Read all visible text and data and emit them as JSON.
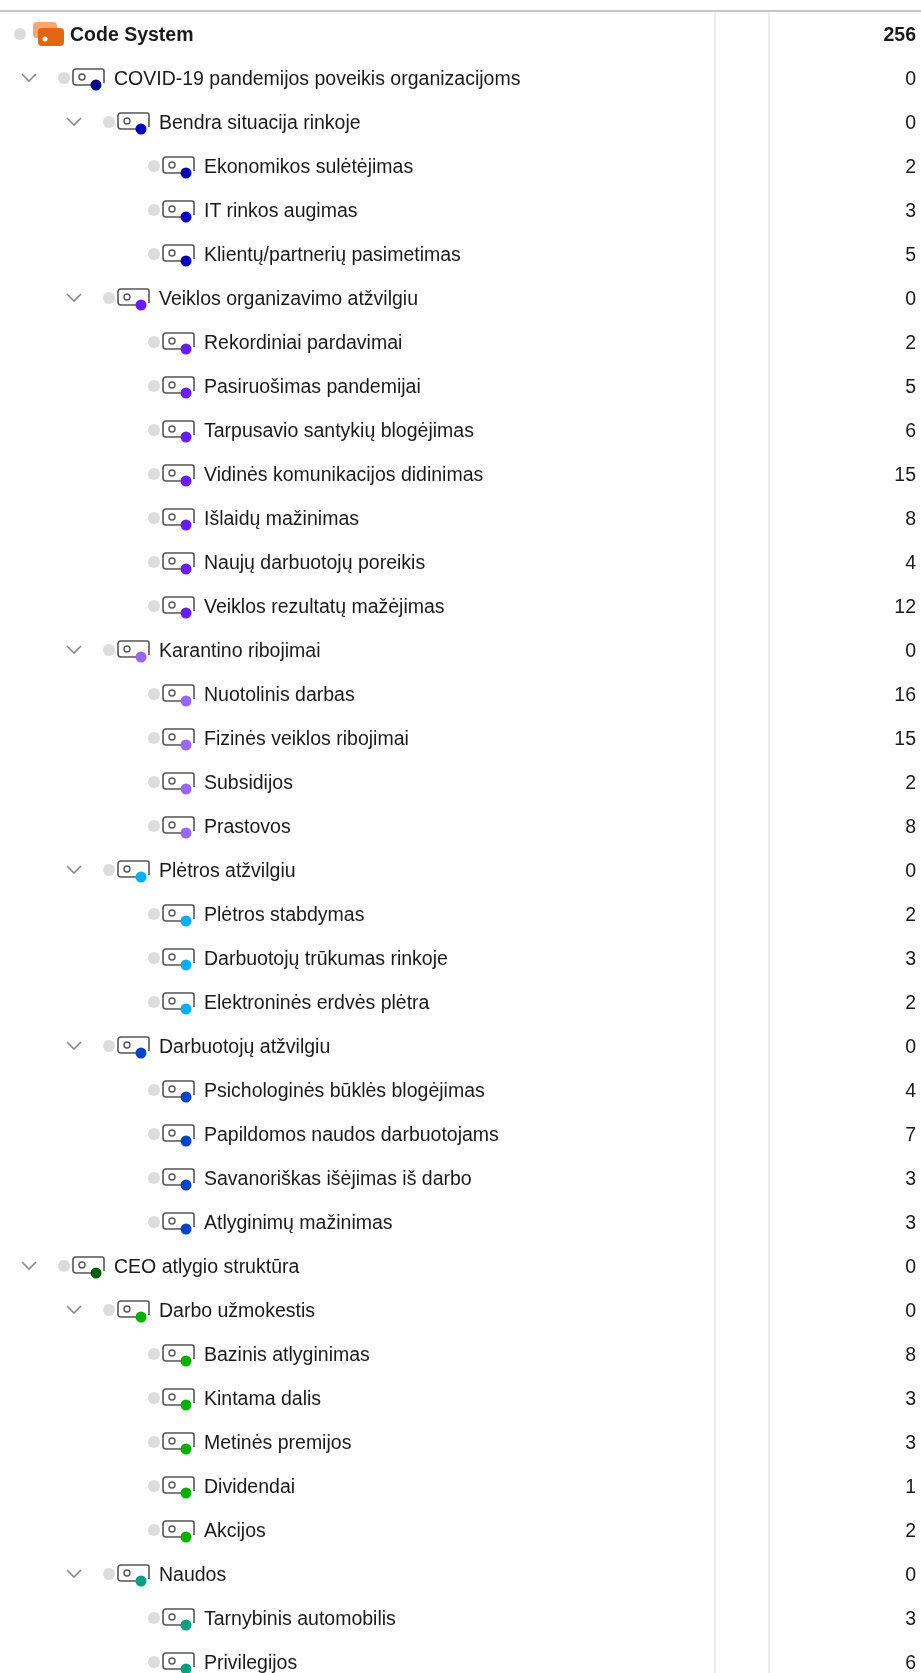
{
  "code_system": {
    "label": "Code System",
    "count": "256",
    "children": [
      {
        "name": "COVID-19 pandemijos poveikis organizacijoms",
        "count": "0",
        "color": "#000080",
        "expanded": true,
        "children": [
          {
            "name": "Bendra situacija rinkoje",
            "count": "0",
            "color": "#0000c0",
            "expanded": true,
            "children": [
              {
                "name": "Ekonomikos sulėtėjimas",
                "count": "2",
                "color": "#0000c0"
              },
              {
                "name": "IT rinkos augimas",
                "count": "3",
                "color": "#0000c0"
              },
              {
                "name": "Klientų/partnerių pasimetimas",
                "count": "5",
                "color": "#0000c0"
              }
            ]
          },
          {
            "name": "Veiklos organizavimo atžvilgiu",
            "count": "0",
            "color": "#6a1bff",
            "expanded": true,
            "children": [
              {
                "name": "Rekordiniai pardavimai",
                "count": "2",
                "color": "#6a1bff"
              },
              {
                "name": "Pasiruošimas pandemijai",
                "count": "5",
                "color": "#6a1bff"
              },
              {
                "name": "Tarpusavio santykių blogėjimas",
                "count": "6",
                "color": "#6a1bff"
              },
              {
                "name": "Vidinės komunikacijos didinimas",
                "count": "15",
                "color": "#6a1bff"
              },
              {
                "name": "Išlaidų mažinimas",
                "count": "8",
                "color": "#6a1bff"
              },
              {
                "name": "Naujų darbuotojų poreikis",
                "count": "4",
                "color": "#6a1bff"
              },
              {
                "name": "Veiklos rezultatų mažėjimas",
                "count": "12",
                "color": "#6a1bff"
              }
            ]
          },
          {
            "name": "Karantino ribojimai",
            "count": "0",
            "color": "#9966ff",
            "expanded": true,
            "children": [
              {
                "name": "Nuotolinis darbas",
                "count": "16",
                "color": "#9966ff"
              },
              {
                "name": "Fizinės veiklos ribojimai",
                "count": "15",
                "color": "#9966ff"
              },
              {
                "name": "Subsidijos",
                "count": "2",
                "color": "#9966ff"
              },
              {
                "name": "Prastovos",
                "count": "8",
                "color": "#9966ff"
              }
            ]
          },
          {
            "name": "Plėtros atžvilgiu",
            "count": "0",
            "color": "#00b0ff",
            "expanded": true,
            "children": [
              {
                "name": "Plėtros stabdymas",
                "count": "2",
                "color": "#00b0ff"
              },
              {
                "name": "Darbuotojų trūkumas rinkoje",
                "count": "3",
                "color": "#00b0ff"
              },
              {
                "name": "Elektroninės erdvės plėtra",
                "count": "2",
                "color": "#00b0ff"
              }
            ]
          },
          {
            "name": "Darbuotojų atžvilgiu",
            "count": "0",
            "color": "#0044cc",
            "expanded": true,
            "children": [
              {
                "name": "Psichologinės būklės blogėjimas",
                "count": "4",
                "color": "#0044cc"
              },
              {
                "name": "Papildomos naudos darbuotojams",
                "count": "7",
                "color": "#0044cc"
              },
              {
                "name": "Savanoriškas išėjimas iš darbo",
                "count": "3",
                "color": "#0044cc"
              },
              {
                "name": "Atlyginimų mažinimas",
                "count": "3",
                "color": "#0044cc"
              }
            ]
          }
        ]
      },
      {
        "name": "CEO atlygio struktūra",
        "count": "0",
        "color": "#006000",
        "expanded": true,
        "children": [
          {
            "name": "Darbo užmokestis",
            "count": "0",
            "color": "#00b000",
            "expanded": true,
            "children": [
              {
                "name": "Bazinis atlyginimas",
                "count": "8",
                "color": "#00b000"
              },
              {
                "name": "Kintama dalis",
                "count": "3",
                "color": "#00b000"
              },
              {
                "name": "Metinės premijos",
                "count": "3",
                "color": "#00b000"
              },
              {
                "name": "Dividendai",
                "count": "1",
                "color": "#00b000"
              },
              {
                "name": "Akcijos",
                "count": "2",
                "color": "#00b000"
              }
            ]
          },
          {
            "name": "Naudos",
            "count": "0",
            "color": "#00a080",
            "expanded": true,
            "children": [
              {
                "name": "Tarnybinis automobilis",
                "count": "3",
                "color": "#00a080"
              },
              {
                "name": "Privilegijos",
                "count": "6",
                "color": "#00a080"
              }
            ]
          }
        ]
      }
    ]
  }
}
